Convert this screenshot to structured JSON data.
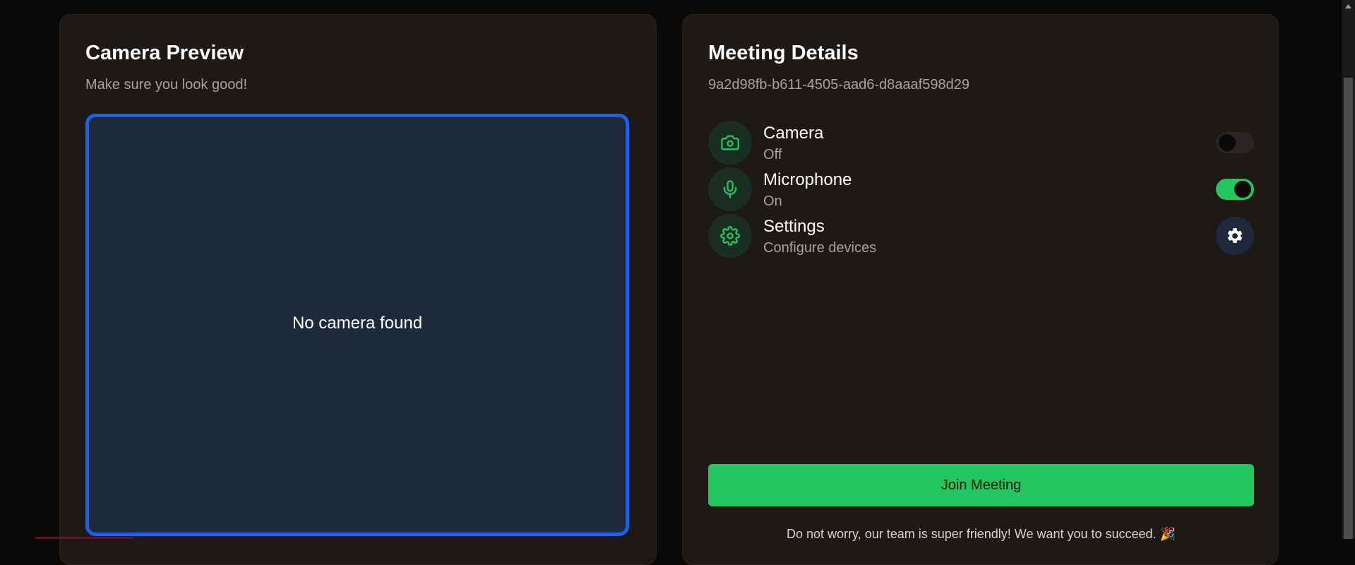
{
  "camera_card": {
    "title": "Camera Preview",
    "subtitle": "Make sure you look good!",
    "preview_message": "No camera found"
  },
  "meeting_card": {
    "title": "Meeting Details",
    "meeting_id": "9a2d98fb-b611-4505-aad6-d8aaaf598d29",
    "devices": [
      {
        "label": "Camera",
        "status": "Off",
        "icon": "camera-icon",
        "control": "toggle",
        "enabled": false
      },
      {
        "label": "Microphone",
        "status": "On",
        "icon": "microphone-icon",
        "control": "toggle",
        "enabled": true
      },
      {
        "label": "Settings",
        "status": "Configure devices",
        "icon": "gear-icon",
        "control": "button"
      }
    ],
    "join_label": "Join Meeting",
    "footnote": "Do not worry, our team is super friendly! We want you to succeed. 🎉"
  },
  "colors": {
    "page_bg": "#0a0908",
    "card_bg": "#1c1917",
    "accent_green": "#22c55e",
    "preview_border": "#1d5fe8",
    "preview_bg": "#1e293b",
    "muted_text": "#a8a29e"
  }
}
